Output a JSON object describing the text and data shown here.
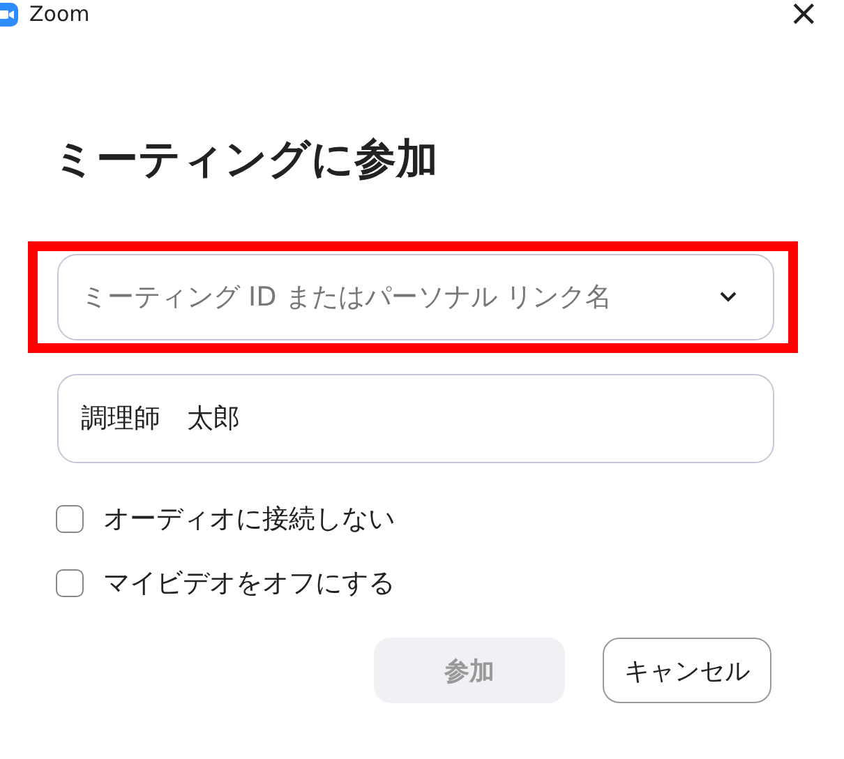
{
  "window": {
    "title": "Zoom",
    "close": "×"
  },
  "heading": "ミーティングに参加",
  "meeting_field": {
    "placeholder": "ミーティング ID またはパーソナル リンク名",
    "highlighted": true
  },
  "name_field": {
    "value": "調理師　太郎"
  },
  "options": [
    {
      "label": "オーディオに接続しない",
      "checked": false
    },
    {
      "label": "マイビデオをオフにする",
      "checked": false
    }
  ],
  "buttons": [
    {
      "label": "参加",
      "kind": "primary",
      "disabled": true
    },
    {
      "label": "キャンセル",
      "kind": "secondary"
    }
  ]
}
